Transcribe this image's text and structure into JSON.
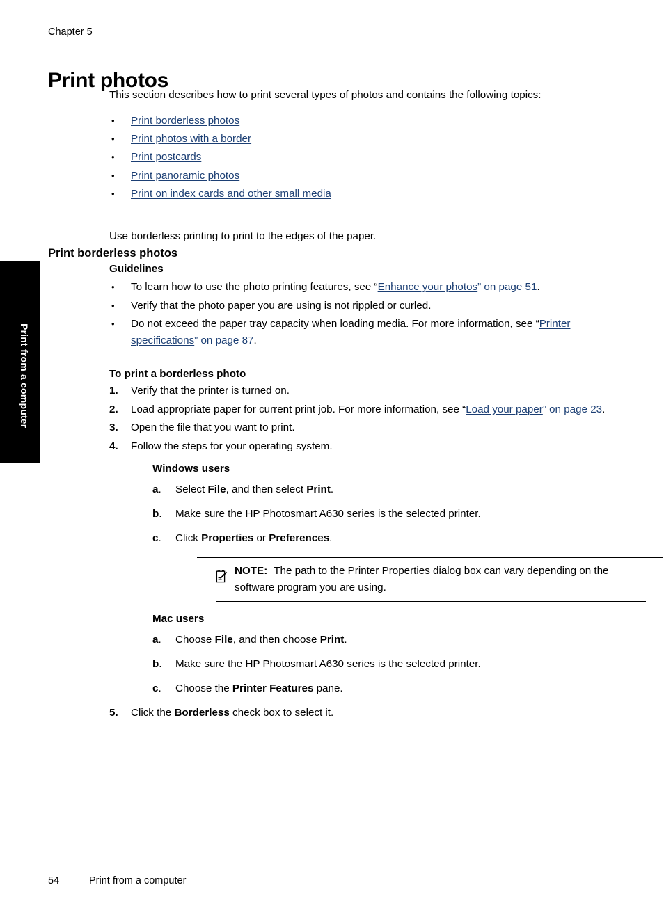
{
  "document": {
    "chapter_label": "Chapter 5",
    "page_title": "Print photos",
    "edge_tab_label": "Print from a computer",
    "footer_page_number": "54",
    "footer_running_title": "Print from a computer",
    "link_color": "#1c3f74"
  },
  "intro": {
    "paragraph": "This section describes how to print several types of photos and contains the following topics:"
  },
  "topics": [
    {
      "label": "Print borderless photos"
    },
    {
      "label": "Print photos with a border"
    },
    {
      "label": "Print postcards"
    },
    {
      "label": "Print panoramic photos"
    },
    {
      "label": "Print on index cards and other small media"
    }
  ],
  "section": {
    "heading": "Print borderless photos",
    "intro": "Use borderless printing to print to the edges of the paper."
  },
  "guidelines": {
    "heading": "Guidelines",
    "items": [
      {
        "text_before": "To learn how to use the photo printing features, see “",
        "link": "Enhance your photos",
        "text_mid": "” ",
        "page_ref": "on page 51",
        "text_after": "."
      },
      {
        "text_before": "Verify that the photo paper you are using is not rippled or curled.",
        "link": "",
        "text_mid": "",
        "page_ref": "",
        "text_after": ""
      },
      {
        "text_before": "Do not exceed the paper tray capacity when loading media. For more information, see “",
        "link": "Printer specifications",
        "text_mid": "” ",
        "page_ref": "on page 87",
        "text_after": "."
      }
    ]
  },
  "procedure": {
    "heading": "To print a borderless photo",
    "steps": [
      {
        "num": "1.",
        "text": "Verify that the printer is turned on."
      },
      {
        "num": "2.",
        "text_before": "Load appropriate paper for current print job. For more information, see “",
        "link": "Load your paper",
        "text_mid": "” ",
        "page_ref": "on page 23",
        "text_after": "."
      },
      {
        "num": "3.",
        "text": "Open the file that you want to print."
      },
      {
        "num": "4.",
        "text": "Follow the steps for your operating system."
      },
      {
        "num": "5.",
        "text_before": "Click the ",
        "bold1": "Borderless",
        "text_after": " check box to select it."
      }
    ]
  },
  "windows": {
    "heading": "Windows users",
    "substeps": [
      {
        "letter": "a",
        "seg1": "Select ",
        "bold1": "File",
        "seg2": ", and then select ",
        "bold2": "Print",
        "seg3": "."
      },
      {
        "letter": "b",
        "seg1": "Make sure the HP Photosmart A630 series is the selected printer.",
        "bold1": "",
        "seg2": "",
        "bold2": "",
        "seg3": ""
      },
      {
        "letter": "c",
        "seg1": "Click ",
        "bold1": "Properties",
        "seg2": " or ",
        "bold2": "Preferences",
        "seg3": "."
      }
    ]
  },
  "note": {
    "icon": "notepad-pencil-icon",
    "label": "NOTE:",
    "text": "The path to the Printer Properties dialog box can vary depending on the software program you are using."
  },
  "mac": {
    "heading": "Mac users",
    "substeps": [
      {
        "letter": "a",
        "seg1": "Choose ",
        "bold1": "File",
        "seg2": ", and then choose ",
        "bold2": "Print",
        "seg3": "."
      },
      {
        "letter": "b",
        "seg1": "Make sure the HP Photosmart A630 series is the selected printer.",
        "bold1": "",
        "seg2": "",
        "bold2": "",
        "seg3": ""
      },
      {
        "letter": "c",
        "seg1": "Choose the ",
        "bold1": "Printer Features",
        "seg2": " pane.",
        "bold2": "",
        "seg3": ""
      }
    ]
  }
}
